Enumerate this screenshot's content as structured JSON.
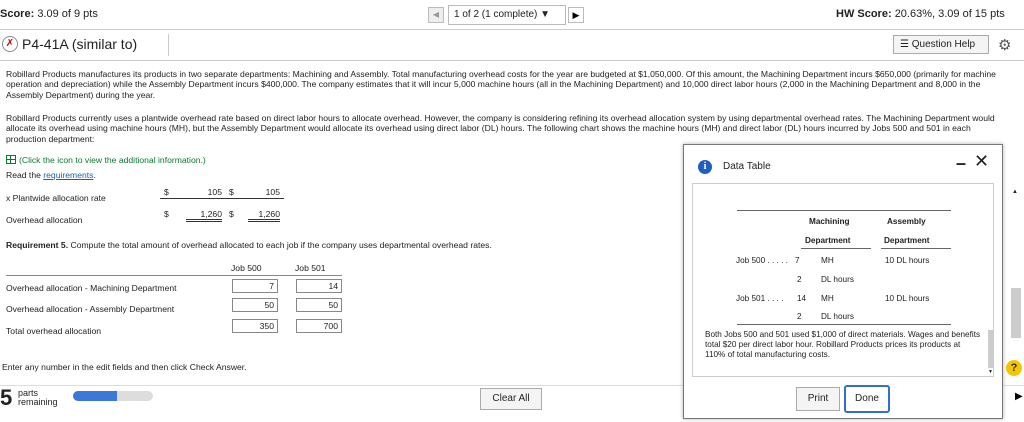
{
  "header": {
    "score_label": "Score:",
    "score_value": "3.09 of 9 pts",
    "nav_position": "1 of 2 (1 complete)",
    "hw_label": "HW Score:",
    "hw_value": "20.63%, 3.09 of 15 pts"
  },
  "titlebar": {
    "title": "P4-41A (similar to)",
    "question_help": "Question Help"
  },
  "problem": {
    "para1": "Robillard Products manufactures its products in two separate departments: Machining and Assembly. Total manufacturing overhead costs for the year are budgeted at $1,050,000. Of this amount, the Machining Department incurs $650,000 (primarily for machine operation and depreciation) while the Assembly Department incurs $400,000. The company estimates that it will incur 5,000 machine hours (all in the Machining Department) and 10,000 direct labor hours (2,000 in the Machining Department and 8,000 in the Assembly Department) during the year.",
    "para2": "Robillard Products currently uses a plantwide overhead rate based on direct labor hours to allocate overhead. However, the company is considering refining its overhead allocation system by using departmental overhead rates. The Machining Department would allocate its overhead using machine hours (MH), but the Assembly Department would allocate its overhead using direct labor (DL) hours. The following chart shows the machine hours (MH) and direct labor (DL) hours incurred by Jobs 500 and 501 in each production department:",
    "click_info": "(Click the icon to view the additional information.)",
    "read_prefix": "Read the",
    "read_link": "requirements",
    "read_suffix": "."
  },
  "work": {
    "row_plantwide_label": "x Plantwide allocation rate",
    "row_plantwide_values": [
      "105",
      "105"
    ],
    "row_overhead_label": "Overhead allocation",
    "row_overhead_values": [
      "1,260",
      "1,260"
    ],
    "dollar": "$",
    "requirement_bold": "Requirement 5.",
    "requirement_text": " Compute the total amount of overhead allocated to each job if the company uses departmental overhead rates.",
    "col_job500": "Job 500",
    "col_job501": "Job 501",
    "row_machining_label": "Overhead allocation - Machining Department",
    "row_machining_values": [
      "7",
      "14"
    ],
    "row_assembly_label": "Overhead allocation - Assembly Department",
    "row_assembly_values": [
      "50",
      "50"
    ],
    "row_total_label": "Total overhead allocation",
    "row_total_values": [
      "350",
      "700"
    ],
    "instruction": "Enter any number in the edit fields and then click Check Answer."
  },
  "footer": {
    "parts_number": "5",
    "parts_label_1": "parts",
    "parts_label_2": "remaining",
    "progress_fraction": 0.55,
    "clear_all": "Clear All"
  },
  "modal": {
    "title": "Data Table",
    "header_machining_1": "Machining",
    "header_machining_2": "Department",
    "header_assembly_1": "Assembly",
    "header_assembly_2": "Department",
    "job500_label": "Job 500",
    "job500_dots": ". . . . .",
    "job500_mh_value": "7",
    "job500_mh_unit": "MH",
    "job500_dl_value": "2",
    "job500_dl_unit": "DL hours",
    "job500_assembly": "10 DL hours",
    "job501_label": "Job 501",
    "job501_dots": ". . . .",
    "job501_mh_value": "14",
    "job501_mh_unit": "MH",
    "job501_dl_value": "2",
    "job501_dl_unit": "DL hours",
    "job501_assembly": "10 DL hours",
    "note": "Both Jobs 500 and 501 used $1,000 of direct materials. Wages and benefits total $20 per direct labor hour. Robillard Products prices its products at 110% of total manufacturing costs.",
    "print": "Print",
    "done": "Done"
  },
  "colors": {
    "accent_blue": "#2f6fd6",
    "progress_blue": "#3b78d8",
    "info_green": "#0a7a2d",
    "help_yellow": "#f6c500"
  },
  "icons": [
    "check-cross-icon",
    "question-help-list-icon",
    "gear-icon",
    "grid-table-icon",
    "info-icon",
    "minimize-icon",
    "close-icon",
    "help-question-icon"
  ]
}
